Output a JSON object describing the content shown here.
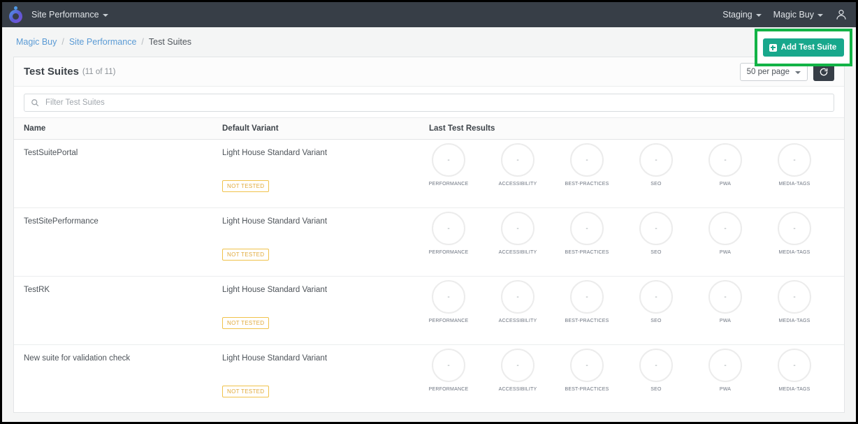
{
  "topnav": {
    "logo_icon": "site-performance-logo",
    "app_menu": "Site Performance",
    "environment": "Staging",
    "account": "Magic Buy",
    "user_icon": "user-avatar-icon"
  },
  "breadcrumb": {
    "items": [
      "Magic Buy",
      "Site Performance",
      "Test Suites"
    ],
    "separator": "/"
  },
  "actions": {
    "add_test_suite": "Add Test Suite",
    "add_icon": "plus-square-icon",
    "highlight_color": "#12b346",
    "button_color": "#18a88c"
  },
  "card": {
    "title": "Test Suites",
    "count": "(11 of 11)",
    "per_page": "50 per page",
    "refresh_icon": "refresh-icon",
    "search_icon": "search-icon",
    "filter_placeholder": "Filter Test Suites",
    "filter_value": ""
  },
  "table": {
    "columns": [
      "Name",
      "Default Variant",
      "Last Test Results"
    ],
    "metrics": [
      "PERFORMANCE",
      "ACCESSIBILITY",
      "BEST-PRACTICES",
      "SEO",
      "PWA",
      "MEDIA-TAGS"
    ],
    "empty_score": "-",
    "rows": [
      {
        "name": "TestSuitePortal",
        "variant": "Light House Standard Variant",
        "status": "NOT TESTED",
        "scores": [
          "-",
          "-",
          "-",
          "-",
          "-",
          "-"
        ]
      },
      {
        "name": "TestSitePerformance",
        "variant": "Light House Standard Variant",
        "status": "NOT TESTED",
        "scores": [
          "-",
          "-",
          "-",
          "-",
          "-",
          "-"
        ]
      },
      {
        "name": "TestRK",
        "variant": "Light House Standard Variant",
        "status": "NOT TESTED",
        "scores": [
          "-",
          "-",
          "-",
          "-",
          "-",
          "-"
        ]
      },
      {
        "name": "New suite for validation check",
        "variant": "Light House Standard Variant",
        "status": "NOT TESTED",
        "scores": [
          "-",
          "-",
          "-",
          "-",
          "-",
          "-"
        ]
      }
    ]
  }
}
